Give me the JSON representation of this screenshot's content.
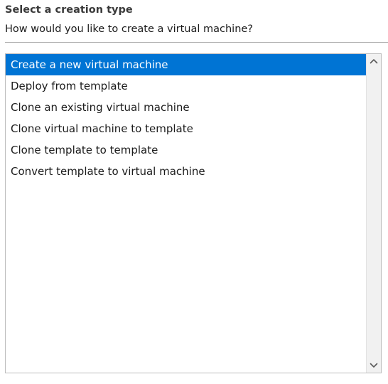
{
  "header": {
    "title": "Select a creation type",
    "subtitle": "How would you like to create a virtual machine?"
  },
  "creation_types": {
    "selected_index": 0,
    "items": [
      {
        "label": "Create a new virtual machine"
      },
      {
        "label": "Deploy from template"
      },
      {
        "label": "Clone an existing virtual machine"
      },
      {
        "label": "Clone virtual machine to template"
      },
      {
        "label": "Clone template to template"
      },
      {
        "label": "Convert template to virtual machine"
      }
    ]
  },
  "scrollbar": {
    "up_icon": "chevron-up-icon",
    "down_icon": "chevron-down-icon"
  },
  "colors": {
    "selection": "#0074d4",
    "selection_text": "#ffffff"
  }
}
